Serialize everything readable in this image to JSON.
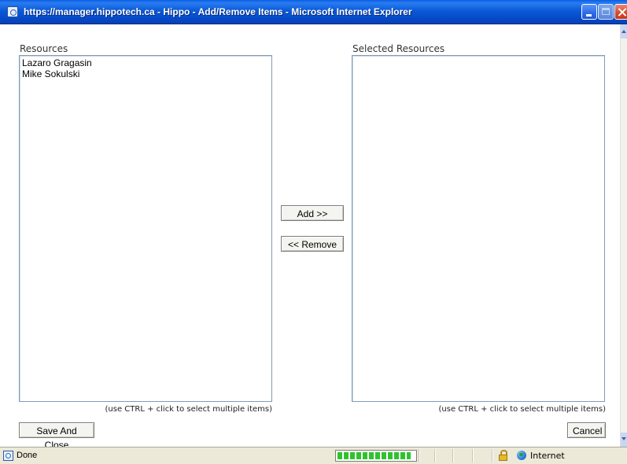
{
  "window": {
    "title": "https://manager.hippotech.ca - Hippo - Add/Remove Items - Microsoft Internet Explorer"
  },
  "resources": {
    "label": "Resources",
    "items": [
      "Lazaro Gragasin",
      "Mike Sokulski"
    ],
    "hint": "(use CTRL + click to select multiple items)"
  },
  "selected": {
    "label": "Selected Resources",
    "items": [],
    "hint": "(use CTRL + click to select multiple items)"
  },
  "actions": {
    "add_label": "Add >>",
    "remove_label": "<< Remove",
    "save_label": "Save And Close",
    "cancel_label": "Cancel"
  },
  "statusbar": {
    "status": "Done",
    "zone": "Internet",
    "progress_fraction": 0.95
  },
  "colors": {
    "titlebar": "#0a5de3",
    "listbox_border": "#7f9db9",
    "statusbar_bg": "#ece9d8",
    "progress_green": "#2ec32e"
  }
}
